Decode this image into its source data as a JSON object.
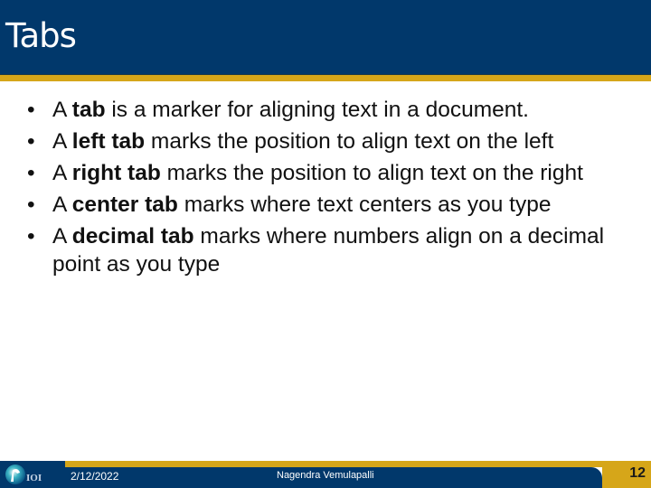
{
  "slide": {
    "title": "Tabs",
    "bullets": [
      {
        "pre": "A ",
        "bold": "tab",
        "post": " is a marker for aligning text in a document."
      },
      {
        "pre": "A ",
        "bold": "left tab",
        "post": " marks the position to align text on the left"
      },
      {
        "pre": "A ",
        "bold": "right tab",
        "post": " marks the position to align text on the right"
      },
      {
        "pre": "A ",
        "bold": "center tab",
        "post": " marks where text centers as you type"
      },
      {
        "pre": "A ",
        "bold": "decimal tab",
        "post": " marks where numbers align on a decimal point as you type"
      }
    ],
    "bullet_glyph": "•"
  },
  "footer": {
    "date": "2/12/2022",
    "author": "Nagendra Vemulapalli",
    "page_number": "12",
    "logo_text": "IOI"
  },
  "colors": {
    "navy": "#01386b",
    "gold": "#d6a619"
  }
}
